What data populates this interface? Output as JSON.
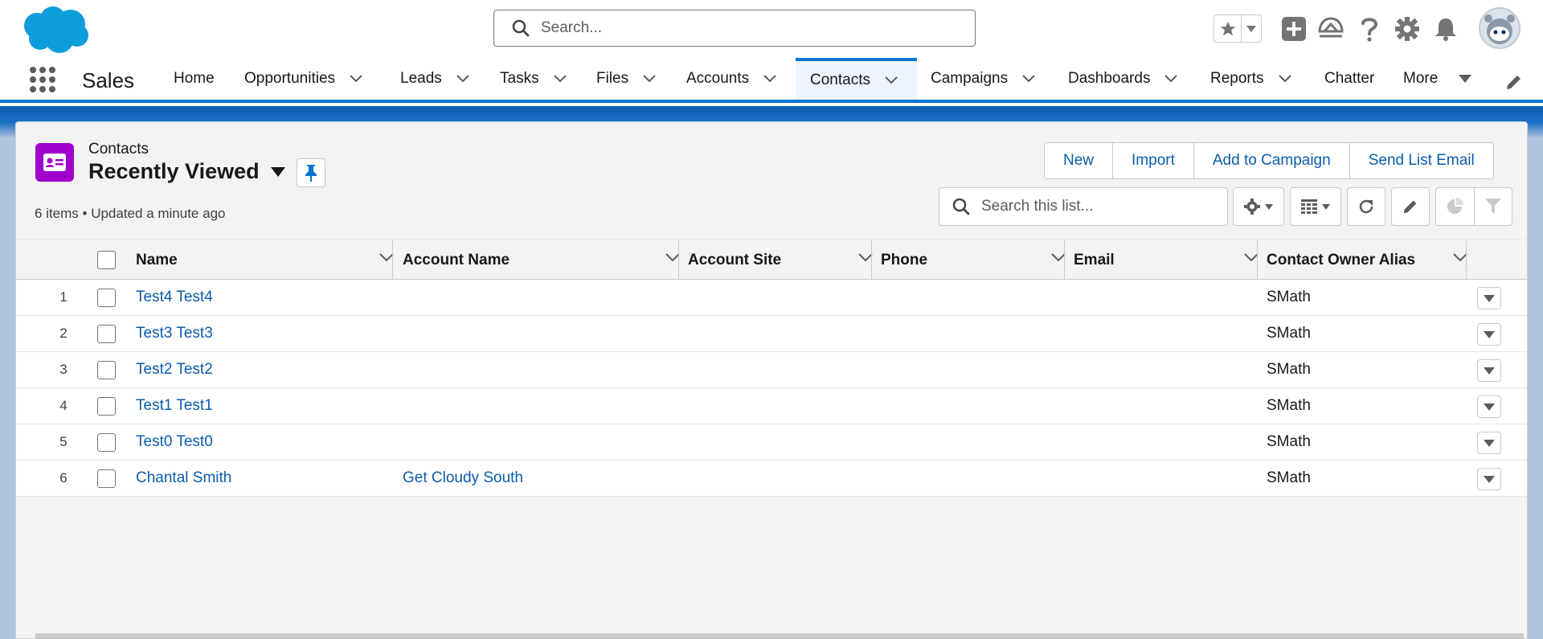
{
  "global_search": {
    "placeholder": "Search..."
  },
  "nav": {
    "app_name": "Sales",
    "items": [
      {
        "label": "Home",
        "dropdown": false
      },
      {
        "label": "Opportunities",
        "dropdown": true
      },
      {
        "label": "Leads",
        "dropdown": true
      },
      {
        "label": "Tasks",
        "dropdown": true
      },
      {
        "label": "Files",
        "dropdown": true
      },
      {
        "label": "Accounts",
        "dropdown": true
      },
      {
        "label": "Contacts",
        "dropdown": true,
        "active": true
      },
      {
        "label": "Campaigns",
        "dropdown": true
      },
      {
        "label": "Dashboards",
        "dropdown": true
      },
      {
        "label": "Reports",
        "dropdown": true
      },
      {
        "label": "Chatter",
        "dropdown": false
      },
      {
        "label": "More",
        "dropdown": true
      }
    ]
  },
  "list_view": {
    "object_label": "Contacts",
    "title": "Recently Viewed",
    "meta": "6 items • Updated a minute ago",
    "actions": [
      "New",
      "Import",
      "Add to Campaign",
      "Send List Email"
    ],
    "search_placeholder": "Search this list..."
  },
  "table": {
    "columns": [
      "Name",
      "Account Name",
      "Account Site",
      "Phone",
      "Email",
      "Contact Owner Alias"
    ],
    "rows": [
      {
        "num": "1",
        "name": "Test4 Test4",
        "account": "",
        "site": "",
        "phone": "",
        "email": "",
        "owner": "SMath"
      },
      {
        "num": "2",
        "name": "Test3 Test3",
        "account": "",
        "site": "",
        "phone": "",
        "email": "",
        "owner": "SMath"
      },
      {
        "num": "3",
        "name": "Test2 Test2",
        "account": "",
        "site": "",
        "phone": "",
        "email": "",
        "owner": "SMath"
      },
      {
        "num": "4",
        "name": "Test1 Test1",
        "account": "",
        "site": "",
        "phone": "",
        "email": "",
        "owner": "SMath"
      },
      {
        "num": "5",
        "name": "Test0 Test0",
        "account": "",
        "site": "",
        "phone": "",
        "email": "",
        "owner": "SMath"
      },
      {
        "num": "6",
        "name": "Chantal Smith",
        "account": "Get Cloudy South",
        "site": "",
        "phone": "",
        "email": "",
        "owner": "SMath"
      }
    ]
  },
  "colors": {
    "brand": "#0176d3",
    "link": "#0b5cab",
    "contact_icon": "#a100cc"
  },
  "icons": [
    "salesforce-logo",
    "search-icon",
    "star-icon",
    "add-icon",
    "trailhead-icon",
    "help-icon",
    "gear-icon",
    "bell-icon",
    "app-launcher-icon",
    "pencil-icon",
    "pin-icon",
    "refresh-icon",
    "chart-icon",
    "filter-icon",
    "table-icon"
  ]
}
